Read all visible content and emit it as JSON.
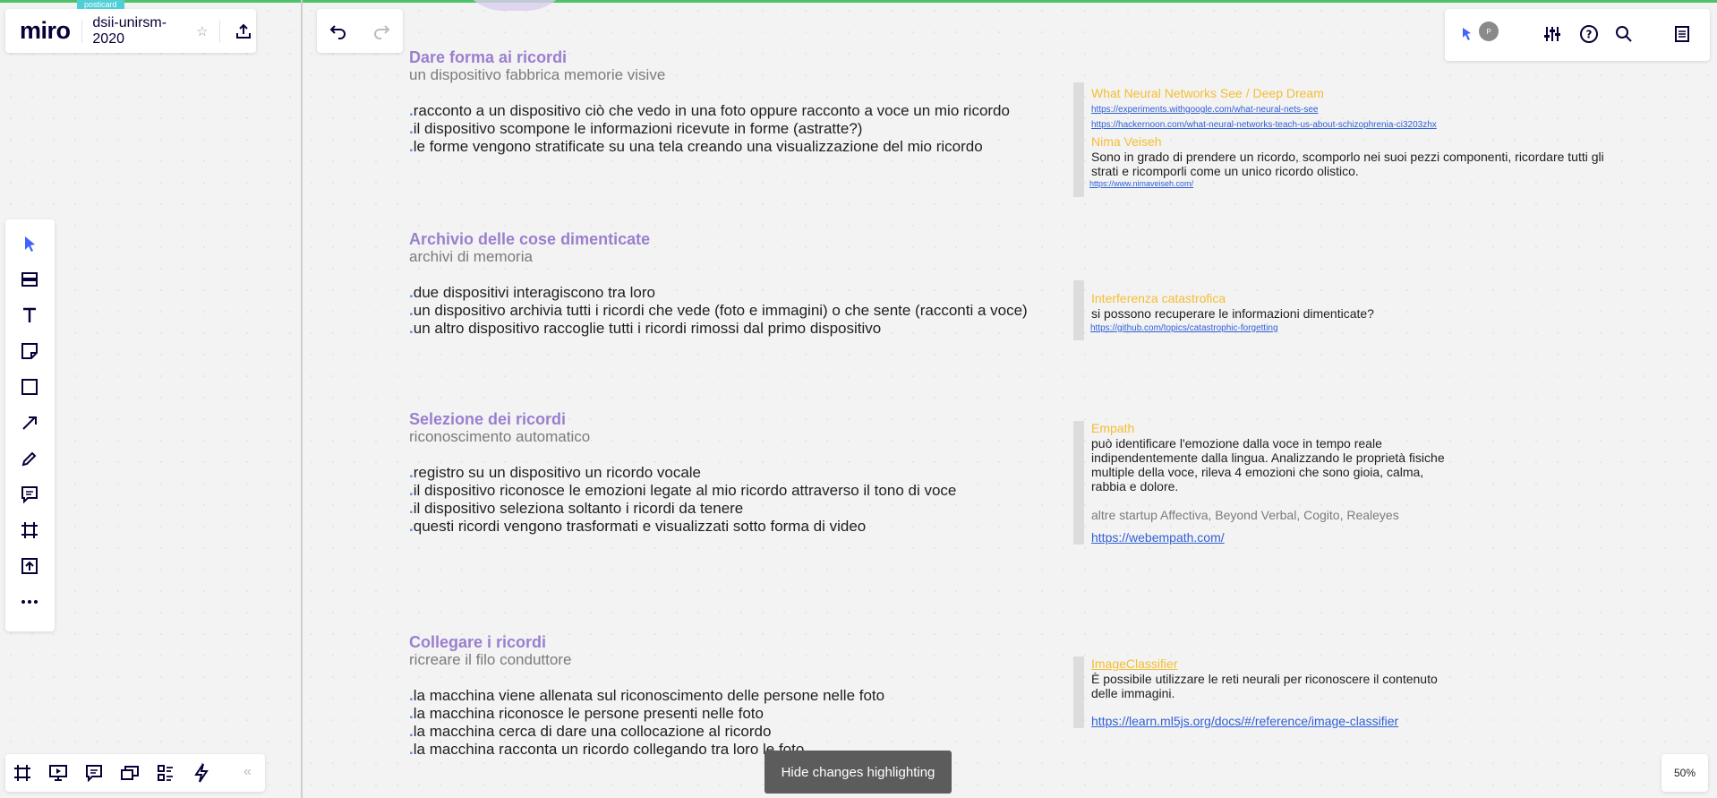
{
  "app": {
    "logo": "miro",
    "board_title": "dsii-unirsm-2020",
    "tag_label": "posticard"
  },
  "toolbar": {
    "hide_changes_label": "Hide changes highlighting",
    "zoom_label": "50%",
    "avatar_initial": "P"
  },
  "sections": [
    {
      "title": "Dare forma ai ricordi",
      "subtitle": "un dispositivo fabbrica memorie visive",
      "items": [
        "racconto a un dispositivo ciò che vedo in una foto oppure racconto a voce un mio ricordo",
        "il dispositivo scompone le informazioni ricevute in forme (astratte?)",
        "le forme vengono stratificate su una tela creando una visualizzazione del mio ricordo"
      ]
    },
    {
      "title": "Archivio delle cose dimenticate",
      "subtitle": "archivi di memoria",
      "items": [
        "due dispositivi interagiscono tra loro",
        "un dispositivo archivia tutti i ricordi che vede (foto e immagini) o che sente (racconti a voce)",
        "un altro dispositivo raccoglie tutti i ricordi rimossi dal primo dispositivo"
      ]
    },
    {
      "title": "Selezione dei ricordi",
      "subtitle": "riconoscimento automatico",
      "items": [
        "registro su un dispositivo un ricordo vocale",
        "il dispositivo riconosce le emozioni legate al mio ricordo attraverso il tono di voce",
        "il dispositivo seleziona soltanto i ricordi da tenere",
        "questi ricordi vengono trasformati e visualizzati sotto forma di video"
      ]
    },
    {
      "title": "Collegare i ricordi",
      "subtitle": "ricreare il filo conduttore",
      "items": [
        "la macchina viene allenata sul riconoscimento delle persone nelle foto",
        "la macchina riconosce le persone presenti nelle foto",
        "la macchina cerca di dare una collocazione al ricordo",
        "la macchina racconta un ricordo collegando tra loro le foto"
      ]
    }
  ],
  "refs": {
    "deepdream": {
      "title": "What Neural Networks See / Deep Dream",
      "link1": "https://experiments.withgoogle.com/what-neural-nets-see",
      "link2": "https://hackernoon.com/what-neural-networks-teach-us-about-schizophrenia-ci3203zhx",
      "author": "Nima Veiseh",
      "text1": "Sono in grado di prendere un ricordo, scomporlo nei suoi pezzi componenti, ricordare tutti gli",
      "text2": "strati e ricomporli come un unico ricordo olistico.",
      "link3": "https://www.nimaveiseh.com/"
    },
    "interferenza": {
      "title": "Interferenza catastrofica",
      "text": "si possono recuperare le informazioni dimenticate?",
      "link": "https://github.com/topics/catastrophic-forgetting"
    },
    "empath": {
      "title": "Empath",
      "text1": "può identificare l'emozione dalla voce in tempo reale",
      "text2": "indipendentemente dalla lingua. Analizzando le proprietà fisiche",
      "text3": "multiple della voce, rileva 4 emozioni che sono gioia, calma,",
      "text4": "rabbia e dolore.",
      "extra": "altre startup Affectiva, Beyond Verbal, Cogito, Realeyes",
      "link": "https://webempath.com/"
    },
    "classifier": {
      "title": "ImageClassifier",
      "text1": "È possibile utilizzare le reti neurali per riconoscere il contenuto",
      "text2": "delle immagini.",
      "link": "https://learn.ml5js.org/docs/#/reference/image-classifier"
    }
  }
}
